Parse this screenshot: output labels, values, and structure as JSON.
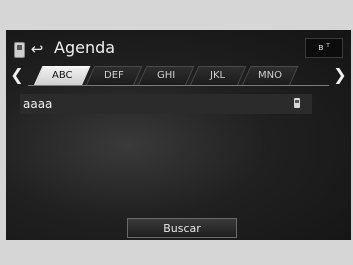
{
  "header": {
    "title": "Agenda",
    "phone_icon": "phone-icon",
    "back_icon": "back-arrow-icon",
    "status_icon": "bluetooth-signal-icon"
  },
  "tabs": [
    {
      "label": "ABC",
      "active": true
    },
    {
      "label": "DEF",
      "active": false
    },
    {
      "label": "GHI",
      "active": false
    },
    {
      "label": "JKL",
      "active": false
    },
    {
      "label": "MNO",
      "active": false
    }
  ],
  "nav": {
    "prev_icon": "chevron-left-icon",
    "next_icon": "chevron-right-icon"
  },
  "contacts": [
    {
      "name": "aaaa",
      "icon": "phone-icon"
    }
  ],
  "footer": {
    "search_label": "Buscar"
  }
}
